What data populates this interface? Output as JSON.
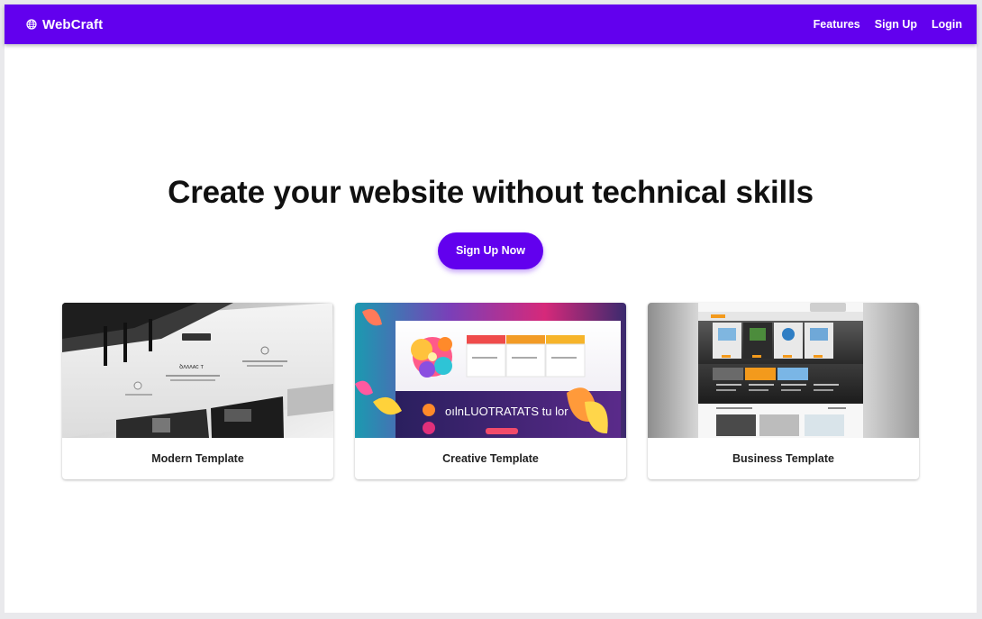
{
  "navbar": {
    "brand": "WebCraft",
    "brand_icon": "globe-icon",
    "links": [
      "Features",
      "Sign Up",
      "Login"
    ],
    "background": "#6200ee"
  },
  "hero": {
    "title": "Create your website without technical skills",
    "cta_label": "Sign Up Now"
  },
  "templates": [
    {
      "title": "Modern Template",
      "preview_heading": "ꝺʌʌʌᴀᴄ ᴛ"
    },
    {
      "title": "Creative Template",
      "preview_heading": "oılnLUOTRATATS tu lor"
    },
    {
      "title": "Business Template"
    }
  ]
}
